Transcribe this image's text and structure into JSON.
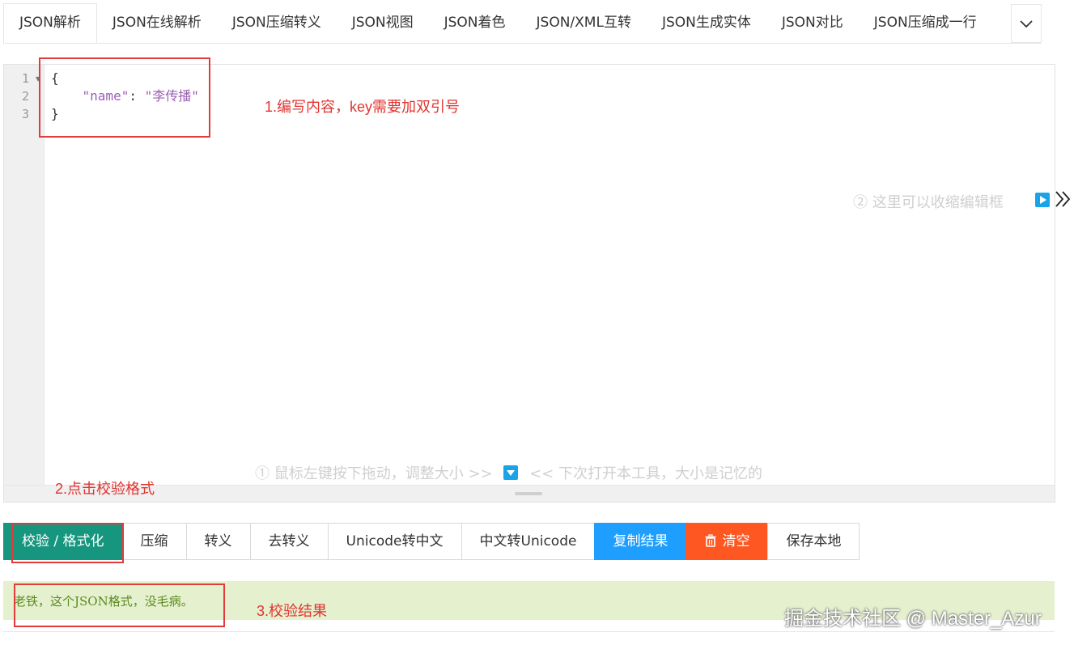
{
  "tabs": [
    {
      "label": "JSON解析"
    },
    {
      "label": "JSON在线解析"
    },
    {
      "label": "JSON压缩转义"
    },
    {
      "label": "JSON视图"
    },
    {
      "label": "JSON着色"
    },
    {
      "label": "JSON/XML互转"
    },
    {
      "label": "JSON生成实体"
    },
    {
      "label": "JSON对比"
    },
    {
      "label": "JSON压缩成一行"
    }
  ],
  "editor": {
    "line_numbers": [
      "1",
      "2",
      "3"
    ],
    "code": {
      "open": "{",
      "key": "\"name\"",
      "colon": ": ",
      "value": "\"李传播\"",
      "close": "}"
    },
    "hint_collapse": "② 这里可以收缩编辑框",
    "hint_resize_left": "① 鼠标左键按下拖动，调整大小 >>",
    "hint_resize_right": "<< 下次打开本工具，大小是记忆的"
  },
  "annotations": {
    "step1": "1.编写内容，key需要加双引号",
    "step2": "2.点击校验格式",
    "step3": "3.校验结果"
  },
  "buttons": {
    "validate": "校验 / 格式化",
    "compress": "压缩",
    "escape": "转义",
    "unescape": "去转义",
    "unicode_to_cn": "Unicode转中文",
    "cn_to_unicode": "中文转Unicode",
    "copy": "复制结果",
    "clear": "清空",
    "save": "保存本地"
  },
  "result": {
    "text": "老铁，这个JSON格式，没毛病。"
  },
  "watermark": "掘金技术社区 @ Master_Azur",
  "colors": {
    "primary": "#16967f",
    "blue": "#1e9fff",
    "orange": "#ff5722",
    "success_bg": "#e5f0cf",
    "annotation": "#e23b3b"
  }
}
